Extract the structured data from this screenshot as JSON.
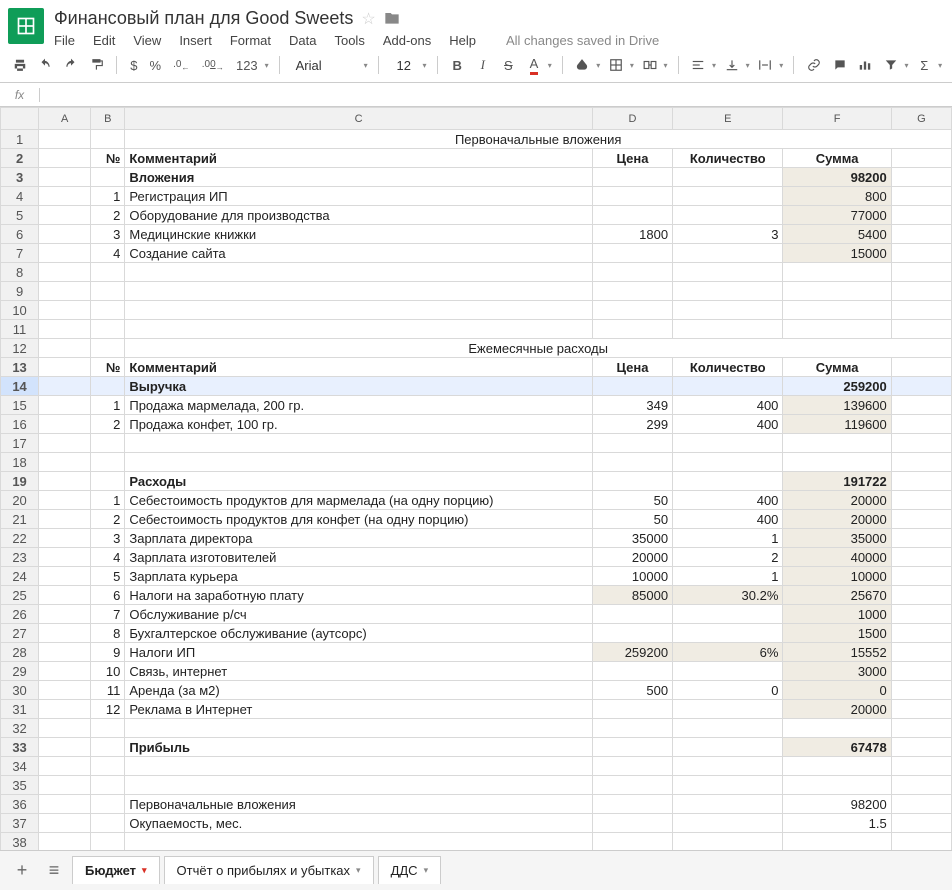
{
  "doc": {
    "title": "Финансовый план для Good Sweets",
    "save_status": "All changes saved in Drive"
  },
  "menu": {
    "file": "File",
    "edit": "Edit",
    "view": "View",
    "insert": "Insert",
    "format": "Format",
    "data": "Data",
    "tools": "Tools",
    "addons": "Add-ons",
    "help": "Help"
  },
  "toolbar": {
    "font": "Arial",
    "size": "12",
    "currency": "$",
    "percent": "%",
    "dec_dec": ".0←",
    "inc_dec": ".00→",
    "more_fmt": "123"
  },
  "fx": "fx",
  "columns": [
    "A",
    "B",
    "C",
    "D",
    "E",
    "F",
    "G"
  ],
  "rows": [
    {
      "n": "1",
      "c": "Первоначальные вложения",
      "section": true
    },
    {
      "n": "2",
      "b": "№",
      "c": "Комментарий",
      "d": "Цена",
      "e": "Количество",
      "f": "Сумма",
      "header": true
    },
    {
      "n": "3",
      "c": "Вложения",
      "f": "98200",
      "bold": true,
      "fshade": true
    },
    {
      "n": "4",
      "b": "1",
      "c": "Регистрация ИП",
      "f": "800",
      "fshade": true
    },
    {
      "n": "5",
      "b": "2",
      "c": "Оборудование для производства",
      "f": "77000",
      "fshade": true
    },
    {
      "n": "6",
      "b": "3",
      "c": "Медицинские книжки",
      "d": "1800",
      "e": "3",
      "f": "5400",
      "fshade": true
    },
    {
      "n": "7",
      "b": "4",
      "c": "Создание сайта",
      "f": "15000",
      "fshade": true
    },
    {
      "n": "8"
    },
    {
      "n": "9"
    },
    {
      "n": "10"
    },
    {
      "n": "11"
    },
    {
      "n": "12",
      "c": "Ежемесячные расходы",
      "section": true
    },
    {
      "n": "13",
      "b": "№",
      "c": "Комментарий",
      "d": "Цена",
      "e": "Количество",
      "f": "Сумма",
      "header": true
    },
    {
      "n": "14",
      "c": "Выручка",
      "f": "259200",
      "bold": true,
      "fshade": true,
      "sel": true
    },
    {
      "n": "15",
      "b": "1",
      "c": "Продажа мармелада, 200 гр.",
      "d": "349",
      "e": "400",
      "f": "139600",
      "fshade": true
    },
    {
      "n": "16",
      "b": "2",
      "c": "Продажа конфет, 100 гр.",
      "d": "299",
      "e": "400",
      "f": "119600",
      "fshade": true
    },
    {
      "n": "17"
    },
    {
      "n": "18"
    },
    {
      "n": "19",
      "c": "Расходы",
      "f": "191722",
      "bold": true,
      "fshade": true
    },
    {
      "n": "20",
      "b": "1",
      "c": "Себестоимость продуктов для мармелада (на одну порцию)",
      "d": "50",
      "e": "400",
      "f": "20000",
      "fshade": true
    },
    {
      "n": "21",
      "b": "2",
      "c": "Себестоимость продуктов для конфет (на одну порцию)",
      "d": "50",
      "e": "400",
      "f": "20000",
      "fshade": true
    },
    {
      "n": "22",
      "b": "3",
      "c": "Зарплата директора",
      "d": "35000",
      "e": "1",
      "f": "35000",
      "fshade": true
    },
    {
      "n": "23",
      "b": "4",
      "c": "Зарплата изготовителей",
      "d": "20000",
      "e": "2",
      "f": "40000",
      "fshade": true
    },
    {
      "n": "24",
      "b": "5",
      "c": "Зарплата курьера",
      "d": "10000",
      "e": "1",
      "f": "10000",
      "fshade": true
    },
    {
      "n": "25",
      "b": "6",
      "c": "Налоги на заработную плату",
      "d": "85000",
      "e": "30.2%",
      "f": "25670",
      "dshade": true,
      "eshade": true,
      "fshade": true
    },
    {
      "n": "26",
      "b": "7",
      "c": "Обслуживание р/сч",
      "f": "1000",
      "fshade": true
    },
    {
      "n": "27",
      "b": "8",
      "c": "Бухгалтерское обслуживание (аутсорс)",
      "f": "1500",
      "fshade": true
    },
    {
      "n": "28",
      "b": "9",
      "c": "Налоги ИП",
      "d": "259200",
      "e": "6%",
      "f": "15552",
      "dshade": true,
      "eshade": true,
      "fshade": true
    },
    {
      "n": "29",
      "b": "10",
      "c": "Связь, интернет",
      "f": "3000",
      "fshade": true
    },
    {
      "n": "30",
      "b": "11",
      "c": "Аренда (за м2)",
      "d": "500",
      "e": "0",
      "f": "0",
      "fshade": true
    },
    {
      "n": "31",
      "b": "12",
      "c": "Реклама в Интернет",
      "f": "20000",
      "fshade": true
    },
    {
      "n": "32"
    },
    {
      "n": "33",
      "c": "Прибыль",
      "f": "67478",
      "bold": true,
      "fshade": true
    },
    {
      "n": "34"
    },
    {
      "n": "35"
    },
    {
      "n": "36",
      "c": "Первоначальные вложения",
      "f": "98200"
    },
    {
      "n": "37",
      "c": "Окупаемость, мес.",
      "f": "1.5"
    },
    {
      "n": "38"
    }
  ],
  "tabs": [
    {
      "label": "Бюджет",
      "active": true
    },
    {
      "label": "Отчёт о прибылях и убытках",
      "active": false
    },
    {
      "label": "ДДС",
      "active": false
    }
  ]
}
